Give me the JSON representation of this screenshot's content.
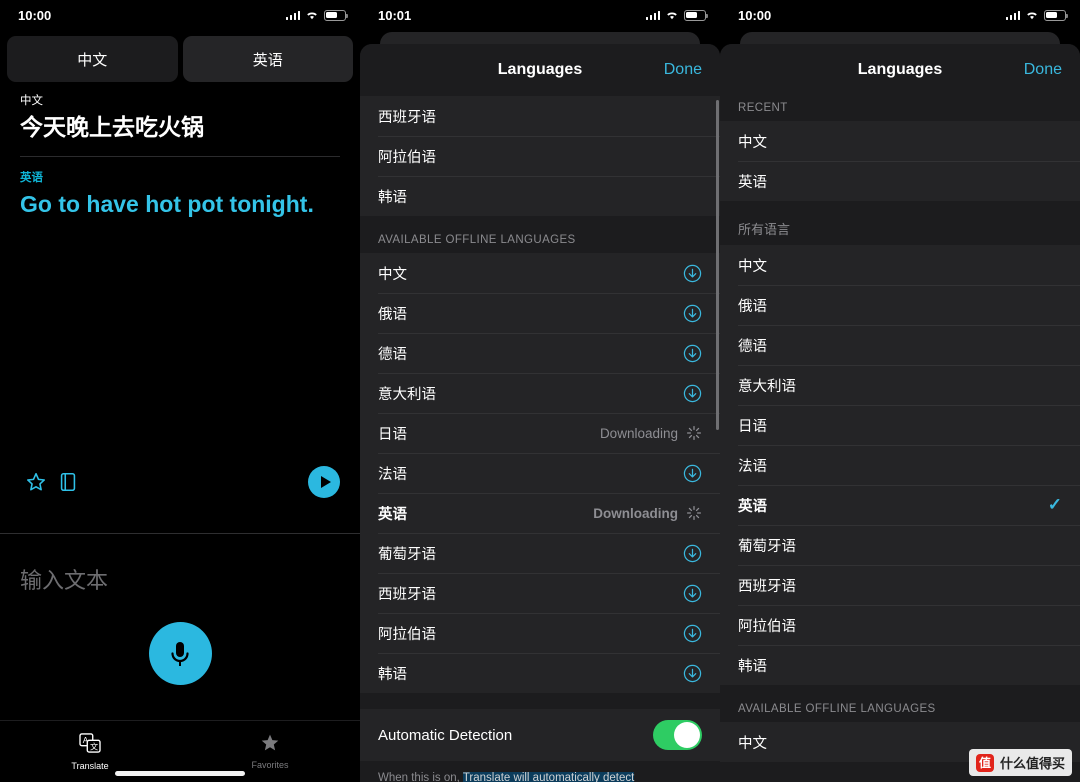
{
  "panel1": {
    "status": {
      "time": "10:00"
    },
    "tabs": [
      {
        "label": "中文"
      },
      {
        "label": "英语"
      }
    ],
    "translation": {
      "source_label": "中文",
      "source_text": "今天晚上去吃火锅",
      "target_label": "英语",
      "target_text": "Go to have hot pot tonight."
    },
    "actions": {
      "favorite_icon": "star-icon",
      "dictionary_icon": "book-icon",
      "play_icon": "play-icon"
    },
    "input_placeholder": "输入文本",
    "mic_icon": "microphone-icon",
    "tabbar": [
      {
        "label": "Translate",
        "icon": "translate-icon",
        "active": true
      },
      {
        "label": "Favorites",
        "icon": "star-icon",
        "active": false
      }
    ]
  },
  "panel2": {
    "status": {
      "time": "10:01"
    },
    "header": {
      "title": "Languages",
      "done": "Done"
    },
    "top_partial_rows": [
      {
        "label": "西班牙语"
      },
      {
        "label": "阿拉伯语"
      },
      {
        "label": "韩语"
      }
    ],
    "section_title": "AVAILABLE OFFLINE LANGUAGES",
    "offline_rows": [
      {
        "label": "中文",
        "status": "",
        "action": "download-icon"
      },
      {
        "label": "俄语",
        "status": "",
        "action": "download-icon"
      },
      {
        "label": "德语",
        "status": "",
        "action": "download-icon"
      },
      {
        "label": "意大利语",
        "status": "",
        "action": "download-icon"
      },
      {
        "label": "日语",
        "status": "Downloading",
        "action": "spinner-icon"
      },
      {
        "label": "法语",
        "status": "",
        "action": "download-icon"
      },
      {
        "label": "英语",
        "status": "Downloading",
        "action": "spinner-icon",
        "bold": true
      },
      {
        "label": "葡萄牙语",
        "status": "",
        "action": "download-icon"
      },
      {
        "label": "西班牙语",
        "status": "",
        "action": "download-icon"
      },
      {
        "label": "阿拉伯语",
        "status": "",
        "action": "download-icon"
      },
      {
        "label": "韩语",
        "status": "",
        "action": "download-icon"
      }
    ],
    "toggle": {
      "label": "Automatic Detection",
      "on": true
    },
    "toggle_note_prefix": "When this is on, ",
    "toggle_note_highlight": "Translate will automatically detect",
    "toggle_note_suffix": ""
  },
  "panel3": {
    "status": {
      "time": "10:00"
    },
    "header": {
      "title": "Languages",
      "done": "Done"
    },
    "recent_title": "RECENT",
    "recent_rows": [
      {
        "label": "中文"
      },
      {
        "label": "英语"
      }
    ],
    "all_title": "所有语言",
    "all_rows": [
      {
        "label": "中文",
        "selected": false
      },
      {
        "label": "俄语",
        "selected": false
      },
      {
        "label": "德语",
        "selected": false
      },
      {
        "label": "意大利语",
        "selected": false
      },
      {
        "label": "日语",
        "selected": false
      },
      {
        "label": "法语",
        "selected": false
      },
      {
        "label": "英语",
        "selected": true
      },
      {
        "label": "葡萄牙语",
        "selected": false
      },
      {
        "label": "西班牙语",
        "selected": false
      },
      {
        "label": "阿拉伯语",
        "selected": false
      },
      {
        "label": "韩语",
        "selected": false
      }
    ],
    "offline_title": "AVAILABLE OFFLINE LANGUAGES",
    "offline_rows": [
      {
        "label": "中文"
      }
    ]
  },
  "watermark": {
    "badge": "值",
    "text": "什么值得买"
  },
  "colors": {
    "accent": "#2bb8e0",
    "link": "#3ab8de",
    "toggle_on": "#2ecc63",
    "sheet_bg": "#1c1c1e",
    "row_bg": "#242426"
  }
}
